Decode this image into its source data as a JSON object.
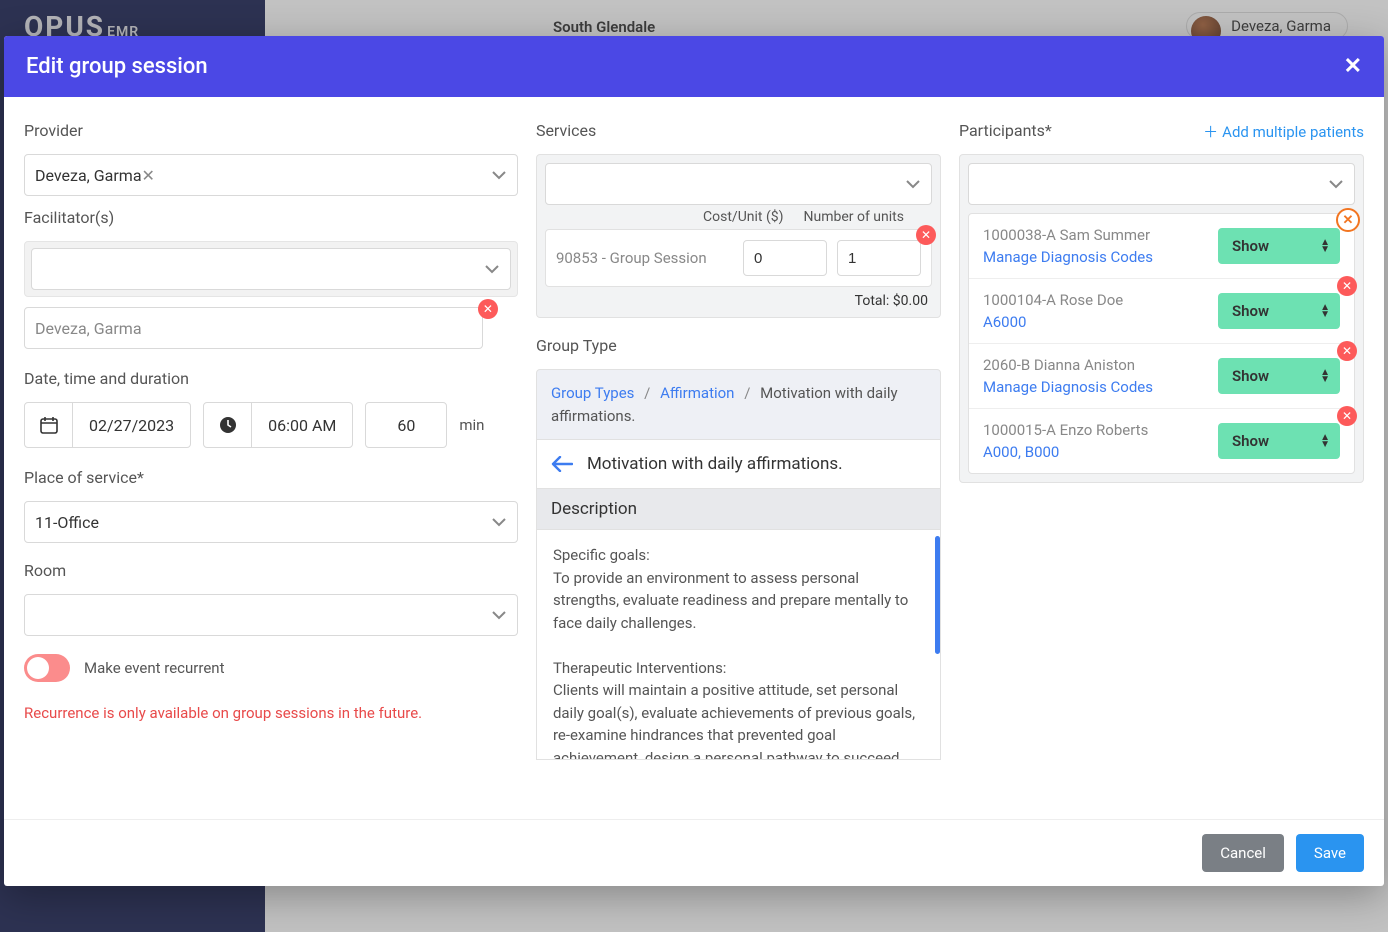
{
  "bg": {
    "logo": "OPUS",
    "logo_small": "EMR",
    "location": "South Glendale",
    "user": "Deveza, Garma"
  },
  "modal": {
    "title": "Edit group session",
    "cancel": "Cancel",
    "save": "Save"
  },
  "left": {
    "provider_label": "Provider",
    "provider_value": "Deveza, Garma",
    "facilitator_label": "Facilitator(s)",
    "facilitator_tag": "Deveza, Garma",
    "dt_label": "Date, time and duration",
    "date": "02/27/2023",
    "time": "06:00 AM",
    "duration": "60",
    "min": "min",
    "pos_label": "Place of service*",
    "pos_value": "11-Office",
    "room_label": "Room",
    "recurrent_label": "Make event recurrent",
    "recurrent_warn": "Recurrence is only available on group sessions in the future."
  },
  "services": {
    "label": "Services",
    "cost_label": "Cost/Unit ($)",
    "units_label": "Number of units",
    "row_name": "90853 - Group Session",
    "cost_value": "0",
    "units_value": "1",
    "total_label": "Total: $0.00"
  },
  "group_type": {
    "label": "Group Type",
    "crumb1": "Group Types",
    "crumb2": "Affirmation",
    "crumb3": "Motivation with daily affirmations.",
    "subtitle": "Motivation with daily affirmations.",
    "desc_head": "Description",
    "goals_head": "Specific goals:",
    "goals_body": "To provide an environment to assess personal strengths, evaluate readiness and prepare mentally to face daily challenges.",
    "ther_head": "Therapeutic Interventions:",
    "ther_body": "Clients will maintain a positive attitude, set personal daily goal(s), evaluate achievements of previous goals, re-examine hindrances that prevented goal achievement, design a personal pathway to succeed and reaffirm believe in self."
  },
  "participants": {
    "label": "Participants*",
    "add_link": "Add multiple patients",
    "show": "Show",
    "items": [
      {
        "name": "1000038-A Sam Summer",
        "link": "Manage Diagnosis Codes"
      },
      {
        "name": "1000104-A Rose Doe",
        "link": "A6000"
      },
      {
        "name": "2060-B Dianna Aniston",
        "link": "Manage Diagnosis Codes"
      },
      {
        "name": "1000015-A Enzo Roberts",
        "link": "A000, B000"
      }
    ]
  }
}
